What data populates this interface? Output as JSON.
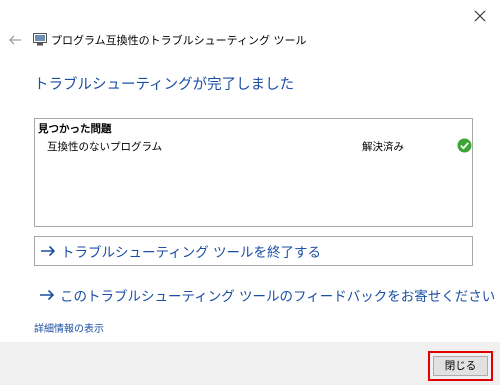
{
  "window": {
    "title": "プログラム互換性のトラブルシューティング ツール"
  },
  "heading": "トラブルシューティングが完了しました",
  "problems": {
    "header": "見つかった問題",
    "items": [
      {
        "name": "互換性のないプログラム",
        "status": "解決済み",
        "icon": "check-icon"
      }
    ]
  },
  "links": {
    "close_tool": "トラブルシューティング ツールを終了する",
    "feedback": "このトラブルシューティング ツールのフィードバックをお寄せください",
    "details": "詳細情報の表示"
  },
  "footer": {
    "close_button": "閉じる"
  },
  "colors": {
    "accent": "#1b4fa4",
    "success": "#3aa535",
    "highlight": "#e00000"
  }
}
